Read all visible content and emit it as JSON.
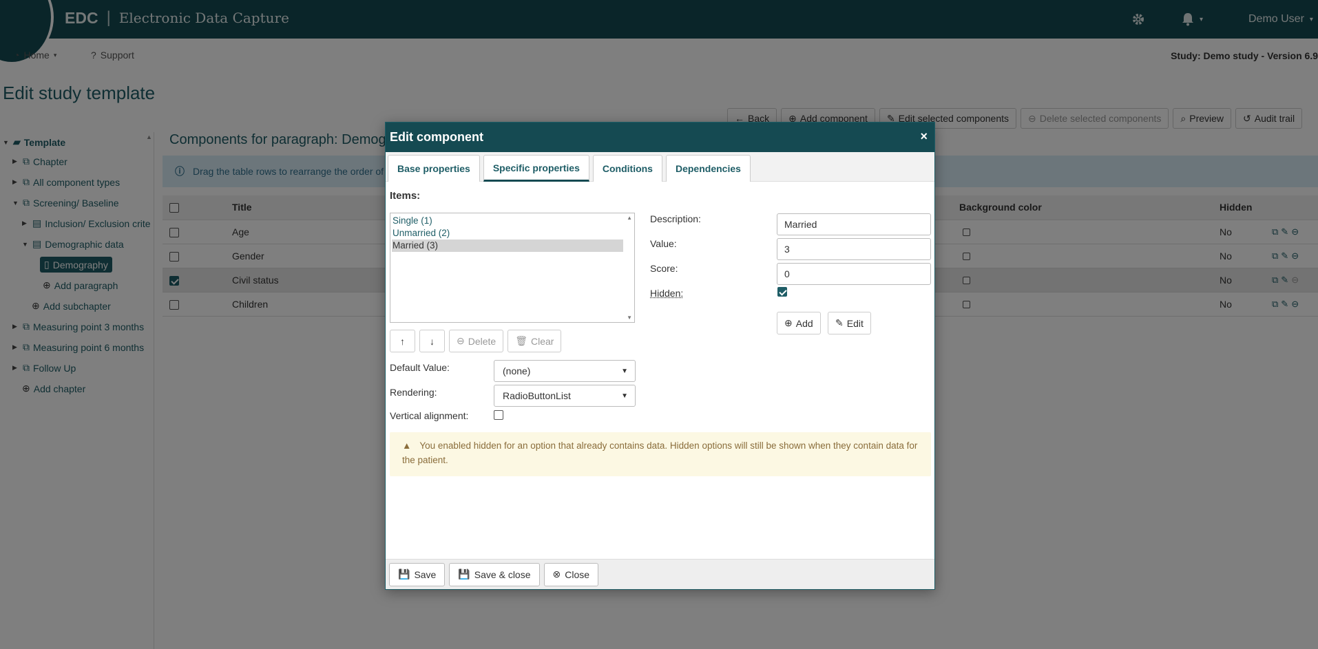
{
  "header": {
    "logo": "EDC",
    "separator": "|",
    "app_name": "Electronic Data Capture",
    "user": "Demo User",
    "colors": {
      "primary": "#154a52",
      "accent": "#1e5d66"
    }
  },
  "subnav": {
    "home": "Home",
    "support": "Support",
    "study": "Study: Demo study - Version 6.9"
  },
  "page_title": "Edit study template",
  "tree": [
    {
      "label": "Template",
      "caret": "▼",
      "bold": true
    },
    {
      "label": "Chapter",
      "caret": "▶"
    },
    {
      "label": "All component types",
      "caret": "▶"
    },
    {
      "label": "Screening/ Baseline",
      "caret": "▼"
    },
    {
      "label": "Inclusion/ Exclusion crite",
      "caret": "▶"
    },
    {
      "label": "Demographic data",
      "caret": "▼"
    },
    {
      "label": "Demography",
      "selected": true
    },
    {
      "label": "Add paragraph"
    },
    {
      "label": "Add subchapter"
    },
    {
      "label": "Measuring point 3 months",
      "caret": "▶"
    },
    {
      "label": "Measuring point 6 months",
      "caret": "▶"
    },
    {
      "label": "Follow Up",
      "caret": "▶"
    },
    {
      "label": "Add chapter"
    }
  ],
  "toolbar": {
    "back": "Back",
    "add_component": "Add component",
    "edit_selected": "Edit selected components",
    "delete_selected": "Delete selected components",
    "preview": "Preview",
    "audit_trail": "Audit trail"
  },
  "components_title": "Components for paragraph: Demog",
  "info_text": "Drag the table rows to rearrange the order of",
  "table": {
    "headers": {
      "title": "Title",
      "background_color": "Background color",
      "hidden": "Hidden"
    },
    "rows": [
      {
        "title": "Age",
        "hidden": "No",
        "checked": false
      },
      {
        "title": "Gender",
        "hidden": "No",
        "checked": false
      },
      {
        "title": "Civil status",
        "hidden": "No",
        "checked": true
      },
      {
        "title": "Children",
        "hidden": "No",
        "checked": false
      }
    ]
  },
  "modal": {
    "title": "Edit component",
    "close_glyph": "×",
    "tabs": [
      "Base properties",
      "Specific properties",
      "Conditions",
      "Dependencies"
    ],
    "active_tab": 1,
    "items_label": "Items:",
    "items": [
      "Single (1)",
      "Unmarried (2)",
      "Married (3)"
    ],
    "selected_item": 2,
    "move_up": "↑",
    "move_down": "↓",
    "delete": "Delete",
    "clear": "Clear",
    "default_value_label": "Default Value:",
    "default_value": "(none)",
    "rendering_label": "Rendering:",
    "rendering": "RadioButtonList",
    "vertical_alignment_label": "Vertical alignment:",
    "vertical_alignment_checked": false,
    "description_label": "Description:",
    "description": "Married",
    "value_label": "Value:",
    "value": "3",
    "score_label": "Score:",
    "score": "0",
    "hidden_label": "Hidden:",
    "hidden_checked": true,
    "add": "Add",
    "edit": "Edit",
    "warning": "You enabled hidden for an option that already contains data. Hidden options will still be shown when they contain data for the patient.",
    "save": "Save",
    "save_close": "Save & close",
    "close": "Close"
  }
}
